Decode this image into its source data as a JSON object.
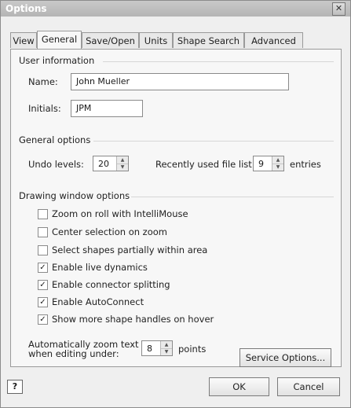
{
  "window": {
    "title": "Options",
    "close_label": "✕"
  },
  "tabs": [
    {
      "label": "View"
    },
    {
      "label": "General"
    },
    {
      "label": "Save/Open"
    },
    {
      "label": "Units"
    },
    {
      "label": "Shape Search"
    },
    {
      "label": "Advanced"
    }
  ],
  "user_info": {
    "heading": "User information",
    "name_label": "Name:",
    "name_value": "John Mueller",
    "initials_label": "Initials:",
    "initials_value": "JPM"
  },
  "general_options": {
    "heading": "General options",
    "undo_label": "Undo levels:",
    "undo_value": "20",
    "recent_label": "Recently used file list:",
    "recent_value": "9",
    "entries_label": "entries"
  },
  "drawing_options": {
    "heading": "Drawing window options",
    "checkboxes": [
      {
        "label": "Zoom on roll with IntelliMouse",
        "checked": false
      },
      {
        "label": "Center selection on zoom",
        "checked": false
      },
      {
        "label": "Select shapes partially within area",
        "checked": false
      },
      {
        "label": "Enable live dynamics",
        "checked": true
      },
      {
        "label": "Enable connector splitting",
        "checked": true
      },
      {
        "label": "Enable AutoConnect",
        "checked": true
      },
      {
        "label": "Show more shape handles on hover",
        "checked": true
      }
    ],
    "zoom_label_line1": "Automatically zoom text",
    "zoom_label_line2": "when editing under:",
    "zoom_value": "8",
    "points_label": "points",
    "service_button": "Service Options..."
  },
  "footer": {
    "help_icon": "?",
    "ok_label": "OK",
    "cancel_label": "Cancel"
  },
  "colors": {
    "titlebar": "#bdbdbd",
    "panel": "#f7f7f7"
  }
}
